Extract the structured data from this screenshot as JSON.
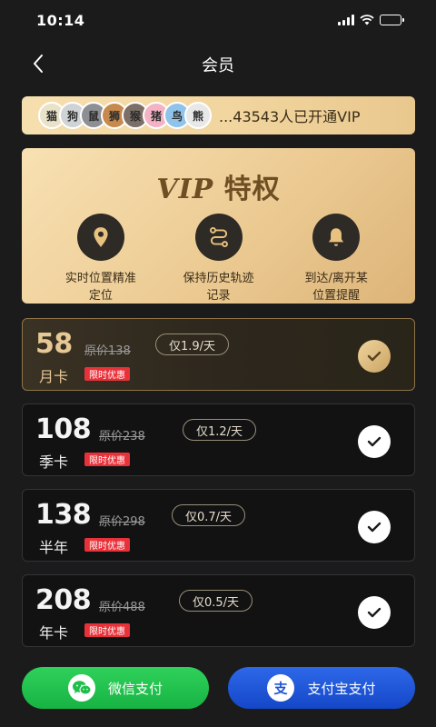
{
  "status_bar": {
    "time": "10:14"
  },
  "nav": {
    "title": "会员",
    "back_icon": "chevron-left-icon"
  },
  "members": {
    "text": "...43543人已开通VIP",
    "avatars": [
      {
        "label": "猫",
        "color": "#e9e2c9"
      },
      {
        "label": "狗",
        "color": "#cfd3d6"
      },
      {
        "label": "鼠",
        "color": "#8d8f93"
      },
      {
        "label": "狮",
        "color": "#c78a4e"
      },
      {
        "label": "猴",
        "color": "#7c6f67"
      },
      {
        "label": "猪",
        "color": "#f3b3c4"
      },
      {
        "label": "鸟",
        "color": "#8fc3ea"
      },
      {
        "label": "熊",
        "color": "#e8e8e8"
      }
    ]
  },
  "vip": {
    "title_en": "VIP",
    "title_cn": "特权",
    "features": [
      {
        "icon": "location-pin-icon",
        "label": "实时位置精准\n定位"
      },
      {
        "icon": "route-track-icon",
        "label": "保持历史轨迹\n记录"
      },
      {
        "icon": "bell-icon",
        "label": "到达/离开某\n位置提醒"
      }
    ]
  },
  "plans": [
    {
      "price": "58",
      "original": "原价138",
      "daily": "仅1.9/天",
      "name": "月卡",
      "badge": "限时优惠",
      "selected": true
    },
    {
      "price": "108",
      "original": "原价238",
      "daily": "仅1.2/天",
      "name": "季卡",
      "badge": "限时优惠",
      "selected": false
    },
    {
      "price": "138",
      "original": "原价298",
      "daily": "仅0.7/天",
      "name": "半年",
      "badge": "限时优惠",
      "selected": false
    },
    {
      "price": "208",
      "original": "原价488",
      "daily": "仅0.5/天",
      "name": "年卡",
      "badge": "限时优惠",
      "selected": false
    }
  ],
  "payments": {
    "wechat": {
      "label": "微信支付",
      "icon": "wechat-icon",
      "color": "#1fbf4b"
    },
    "alipay": {
      "label": "支付宝支付",
      "icon": "alipay-icon",
      "color": "#1f55d6"
    }
  },
  "colors": {
    "background": "#1b1b1c",
    "gold": "#e6c894",
    "badge_red": "#e8323a"
  }
}
